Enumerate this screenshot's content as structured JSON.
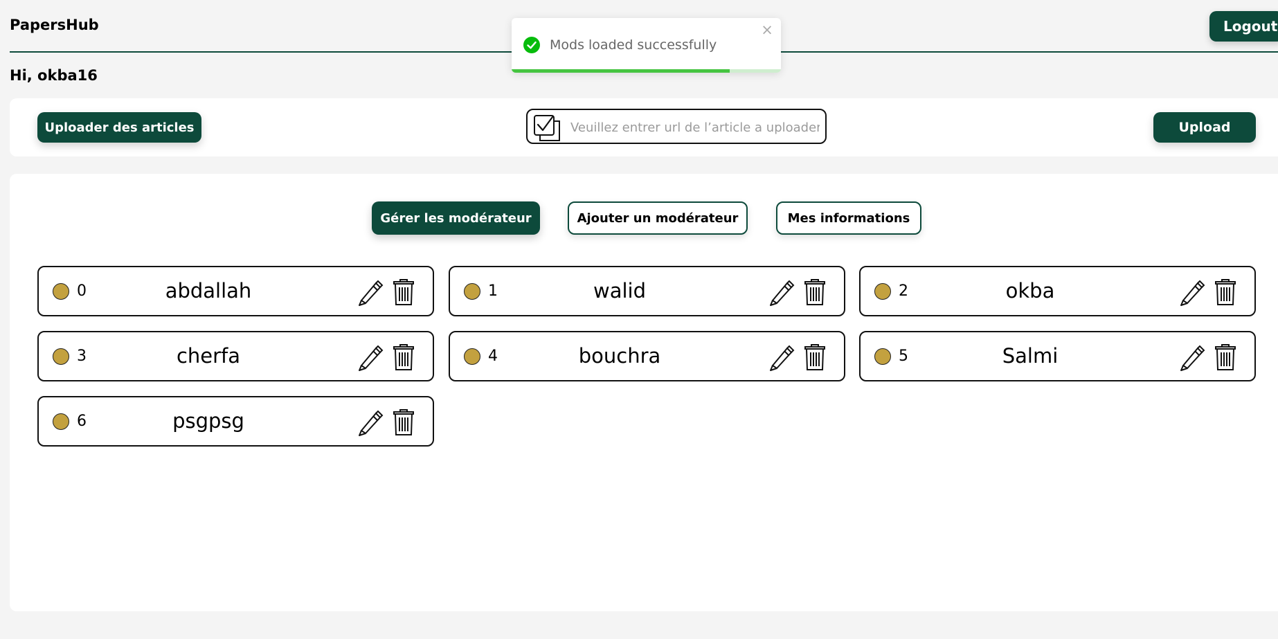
{
  "header": {
    "brand": "PapersHub",
    "logout_label": "Logout"
  },
  "greeting": "Hi, okba16",
  "upload_bar": {
    "uploader_label": "Uploader des articles",
    "url_placeholder": "Veuillez entrer url de l’article a uploader",
    "url_value": "",
    "upload_label": "Upload"
  },
  "tabs": [
    {
      "label": "Gérer les modérateur",
      "active": true
    },
    {
      "label": "Ajouter un modérateur",
      "active": false
    },
    {
      "label": "Mes informations",
      "active": false
    }
  ],
  "moderators": [
    {
      "index": "0",
      "name": "abdallah"
    },
    {
      "index": "1",
      "name": "walid"
    },
    {
      "index": "2",
      "name": "okba"
    },
    {
      "index": "3",
      "name": "cherfa"
    },
    {
      "index": "4",
      "name": "bouchra"
    },
    {
      "index": "5",
      "name": "Salmi"
    },
    {
      "index": "6",
      "name": "psgpsg"
    }
  ],
  "toast": {
    "message": "Mods loaded successfully",
    "close_glyph": "×",
    "progress": 0.81,
    "status_color": "#07bc0c"
  },
  "colors": {
    "brand": "#0d4a3b",
    "status_dot": "#c3a13f"
  },
  "icons": {
    "edit": "pencil-icon",
    "delete": "trash-icon",
    "url_field": "checkbox-copy-icon",
    "toast": "check-circle-icon"
  }
}
